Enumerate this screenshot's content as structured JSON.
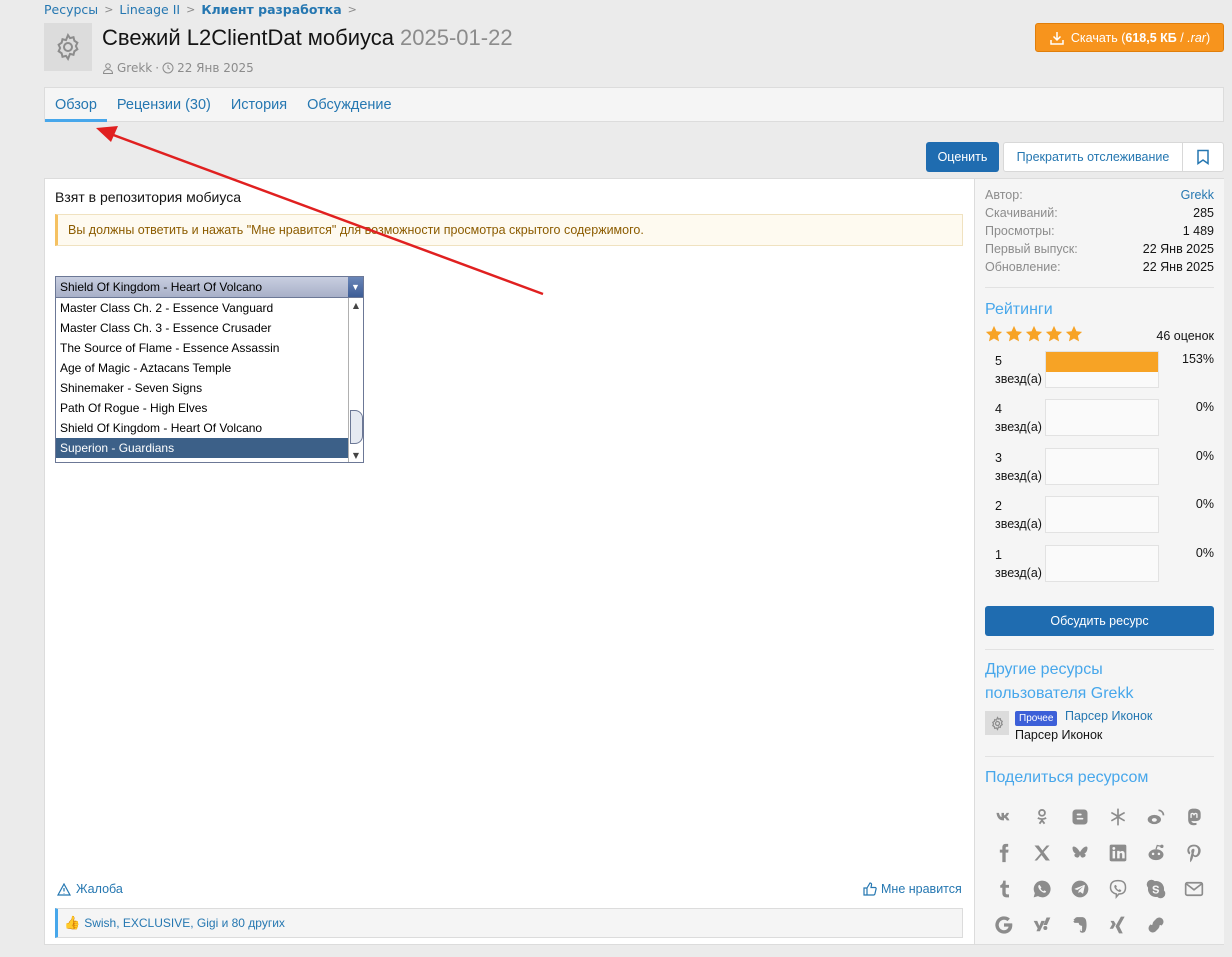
{
  "breadcrumb": {
    "items": [
      "Ресурсы",
      "Lineage II",
      "Клиент разработка"
    ]
  },
  "header": {
    "title": "Свежий L2ClientDat мобиуса",
    "version": "2025-01-22",
    "author": "Grekk",
    "date": "22 Янв 2025",
    "download": {
      "label": "Скачать",
      "size": "618,5 КБ",
      "ext": ".rar"
    }
  },
  "tabs": [
    {
      "label": "Обзор",
      "active": true
    },
    {
      "label": "Рецензии (30)"
    },
    {
      "label": "История"
    },
    {
      "label": "Обсуждение"
    }
  ],
  "actions": {
    "rate": "Оценить",
    "unwatch": "Прекратить отслеживание"
  },
  "content": {
    "intro": "Взят в репозитория мобиуса",
    "notice": "Вы должны ответить и нажать \"Мне нравится\" для возможности просмотра скрытого содержимого.",
    "combo": {
      "selected": "Shield Of Kingdom - Heart Of Volcano",
      "options": [
        "Master Class Ch. 2 - Essence Vanguard",
        "Master Class Ch. 3 - Essence Crusader",
        "The Source of Flame - Essence Assassin",
        "Age of Magic - Aztacans Temple",
        "Shinemaker - Seven Signs",
        "Path Of Rogue - High Elves",
        "Shield Of Kingdom - Heart Of Volcano",
        "Superion - Guardians"
      ],
      "highlighted_index": 7
    },
    "report": "Жалоба",
    "like": "Мне нравится",
    "likes_text": "Swish, EXCLUSIVE, Gigi и 80 других"
  },
  "sidebar": {
    "info": [
      {
        "k": "Автор:",
        "v": "Grekk",
        "link": true
      },
      {
        "k": "Скачиваний:",
        "v": "285"
      },
      {
        "k": "Просмотры:",
        "v": "1 489"
      },
      {
        "k": "Первый выпуск:",
        "v": "22 Янв 2025"
      },
      {
        "k": "Обновление:",
        "v": "22 Янв 2025"
      }
    ],
    "ratings_title": "Рейтинги",
    "stars": 5,
    "ratings_count": "46 оценок",
    "rating_rows": [
      {
        "label": "5 звезд(а)",
        "pct": "153%",
        "fill": 1.0
      },
      {
        "label": "4 звезд(а)",
        "pct": "0%",
        "fill": 0
      },
      {
        "label": "3 звезд(а)",
        "pct": "0%",
        "fill": 0
      },
      {
        "label": "2 звезд(а)",
        "pct": "0%",
        "fill": 0
      },
      {
        "label": "1 звезд(а)",
        "pct": "0%",
        "fill": 0
      }
    ],
    "discuss": "Обсудить ресурс",
    "other_title_1": "Другие ресурсы",
    "other_title_2": "пользователя Grekk",
    "other_resource": {
      "badge": "Прочее",
      "title": "Парсер Иконок",
      "desc": "Парсер Иконок"
    },
    "share_title": "Поделиться ресурсом",
    "share_icons": [
      "vk-icon",
      "odnoklassniki-icon",
      "blogger-icon",
      "livejournal-icon",
      "weibo-icon",
      "mastodon-icon",
      "facebook-icon",
      "x-icon",
      "bluesky-icon",
      "linkedin-icon",
      "reddit-icon",
      "pinterest-icon",
      "tumblr-icon",
      "whatsapp-icon",
      "telegram-icon",
      "viber-icon",
      "skype-icon",
      "email-icon",
      "google-icon",
      "yahoo-icon",
      "evernote-icon",
      "xing-icon",
      "link-icon"
    ]
  },
  "colors": {
    "link": "#2577b1",
    "accent": "#47a7eb",
    "primary_button": "#1f6cb0",
    "download": "#f7941d",
    "star": "#f7a325",
    "arrow": "#e02020"
  }
}
